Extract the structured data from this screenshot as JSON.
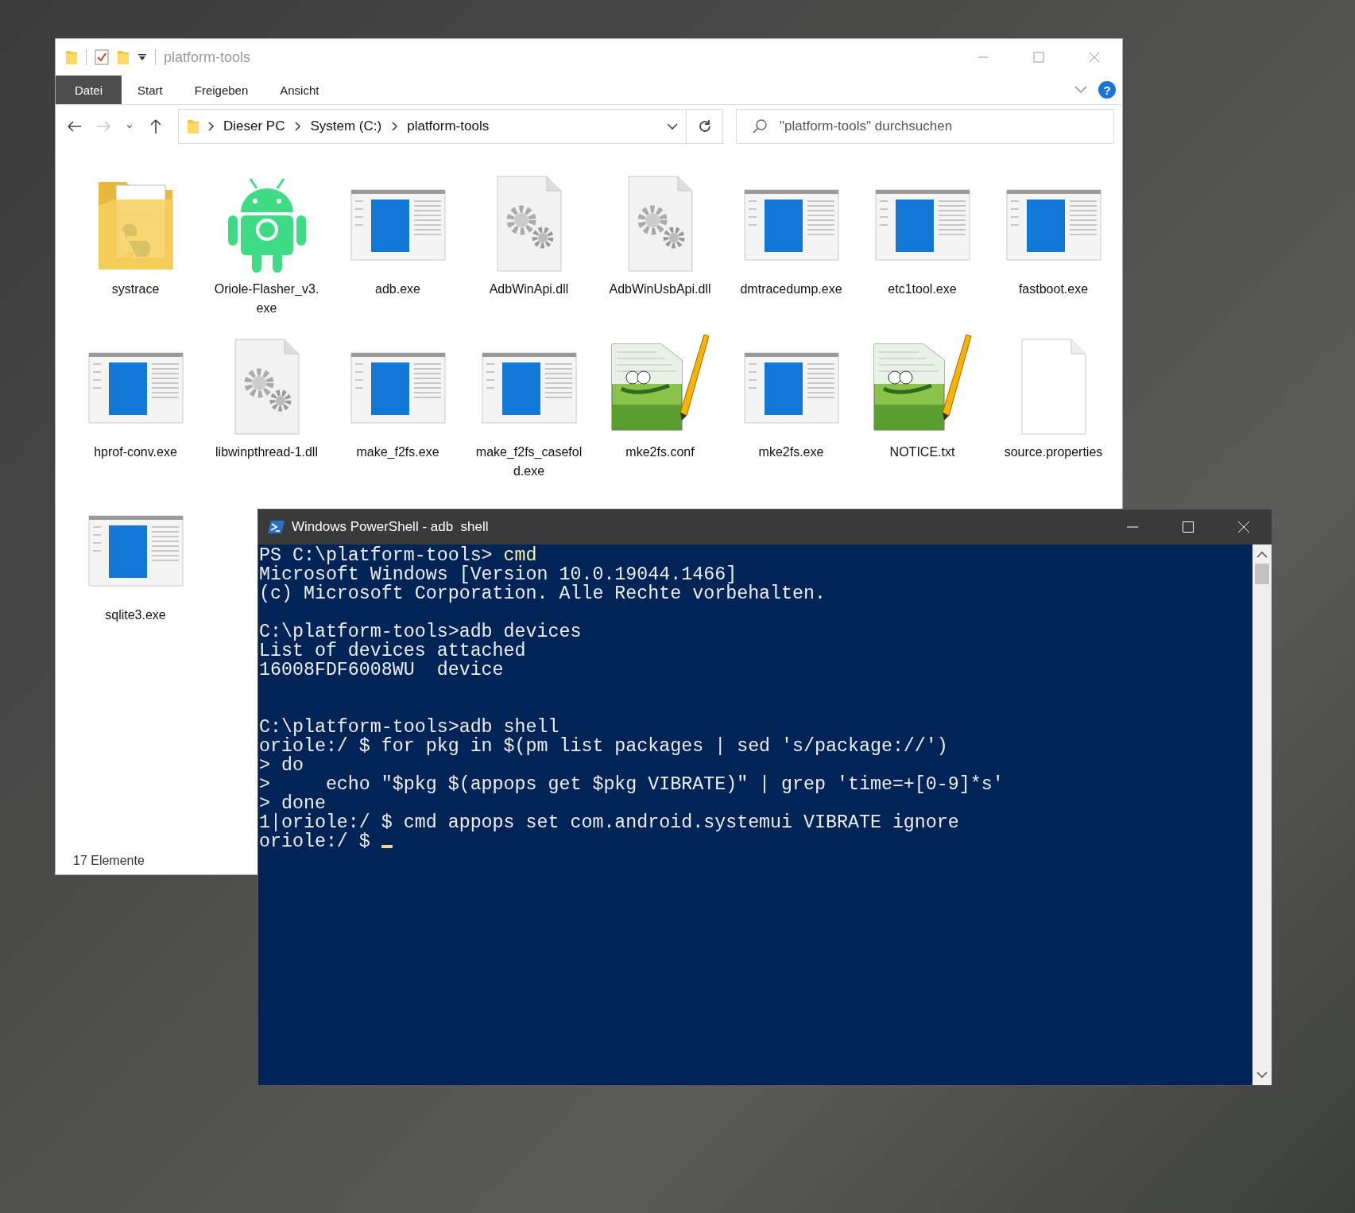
{
  "explorer": {
    "title": "platform-tools",
    "ribbon_tabs": [
      {
        "label": "Datei",
        "selected": true
      },
      {
        "label": "Start",
        "selected": false
      },
      {
        "label": "Freigeben",
        "selected": false
      },
      {
        "label": "Ansicht",
        "selected": false
      }
    ],
    "help": "?",
    "nav_buttons": [
      {
        "kind": "back",
        "disabled": false
      },
      {
        "kind": "forward",
        "disabled": true
      },
      {
        "kind": "recent",
        "disabled": false
      },
      {
        "kind": "up",
        "disabled": false
      }
    ],
    "address": {
      "crumbs": [
        "Dieser PC",
        "System (C:)",
        "platform-tools"
      ]
    },
    "search": {
      "placeholder": "\"platform-tools\" durchsuchen"
    },
    "files": [
      {
        "name": "systrace",
        "kind": "folder"
      },
      {
        "name": "Oriole-Flasher_v3.exe",
        "kind": "android"
      },
      {
        "name": "adb.exe",
        "kind": "app"
      },
      {
        "name": "AdbWinApi.dll",
        "kind": "dll"
      },
      {
        "name": "AdbWinUsbApi.dll",
        "kind": "dll"
      },
      {
        "name": "dmtracedump.exe",
        "kind": "app"
      },
      {
        "name": "etc1tool.exe",
        "kind": "app"
      },
      {
        "name": "fastboot.exe",
        "kind": "app"
      },
      {
        "name": "hprof-conv.exe",
        "kind": "app"
      },
      {
        "name": "libwinpthread-1.dll",
        "kind": "dll"
      },
      {
        "name": "make_f2fs.exe",
        "kind": "app"
      },
      {
        "name": "make_f2fs_casefold.exe",
        "kind": "app"
      },
      {
        "name": "mke2fs.conf",
        "kind": "notepad"
      },
      {
        "name": "mke2fs.exe",
        "kind": "app"
      },
      {
        "name": "NOTICE.txt",
        "kind": "notepad"
      },
      {
        "name": "source.properties",
        "kind": "blank"
      },
      {
        "name": "sqlite3.exe",
        "kind": "app"
      }
    ],
    "status_bar": "17 Elemente"
  },
  "terminal": {
    "title": "Windows PowerShell - adb  shell",
    "lines": [
      {
        "kind": "command",
        "prompt": "PS C:\\platform-tools>",
        "command": "cmd"
      },
      {
        "kind": "output",
        "text": "Microsoft Windows [Version 10.0.19044.1466]"
      },
      {
        "kind": "output",
        "text": "(c) Microsoft Corporation. Alle Rechte vorbehalten."
      },
      {
        "kind": "blank"
      },
      {
        "kind": "output",
        "text": "C:\\platform-tools>adb devices"
      },
      {
        "kind": "output",
        "text": "List of devices attached"
      },
      {
        "kind": "output",
        "text": "16008FDF6008WU  device"
      },
      {
        "kind": "blank"
      },
      {
        "kind": "blank"
      },
      {
        "kind": "output",
        "text": "C:\\platform-tools>adb shell"
      },
      {
        "kind": "output",
        "text": "oriole:/ $ for pkg in $(pm list packages | sed 's/package://')"
      },
      {
        "kind": "output",
        "text": "> do"
      },
      {
        "kind": "output",
        "text": ">     echo \"$pkg $(appops get $pkg VIBRATE)\" | grep 'time=+[0-9]*s'"
      },
      {
        "kind": "output",
        "text": "> done"
      },
      {
        "kind": "output",
        "text": "1|oriole:/ $ cmd appops set com.android.systemui VIBRATE ignore"
      },
      {
        "kind": "cursor",
        "text": "oriole:/ $"
      }
    ]
  }
}
